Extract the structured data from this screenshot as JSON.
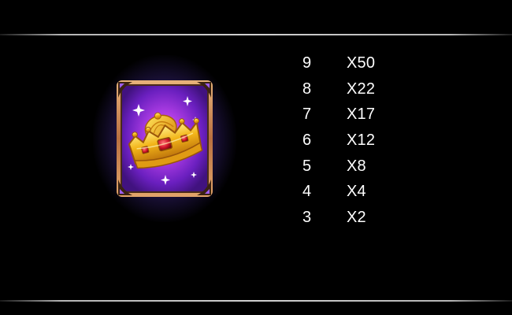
{
  "symbol": {
    "name": "crown-symbol",
    "accent": "#7b2cd6",
    "frame_color": "#c98a4a",
    "gold_color": "#f2b21f",
    "gem_color": "#d4162a"
  },
  "paytable": {
    "rows": [
      {
        "count": "9",
        "multiplier": "X50"
      },
      {
        "count": "8",
        "multiplier": "X22"
      },
      {
        "count": "7",
        "multiplier": "X17"
      },
      {
        "count": "6",
        "multiplier": "X12"
      },
      {
        "count": "5",
        "multiplier": "X8"
      },
      {
        "count": "4",
        "multiplier": "X4"
      },
      {
        "count": "3",
        "multiplier": "X2"
      }
    ]
  }
}
